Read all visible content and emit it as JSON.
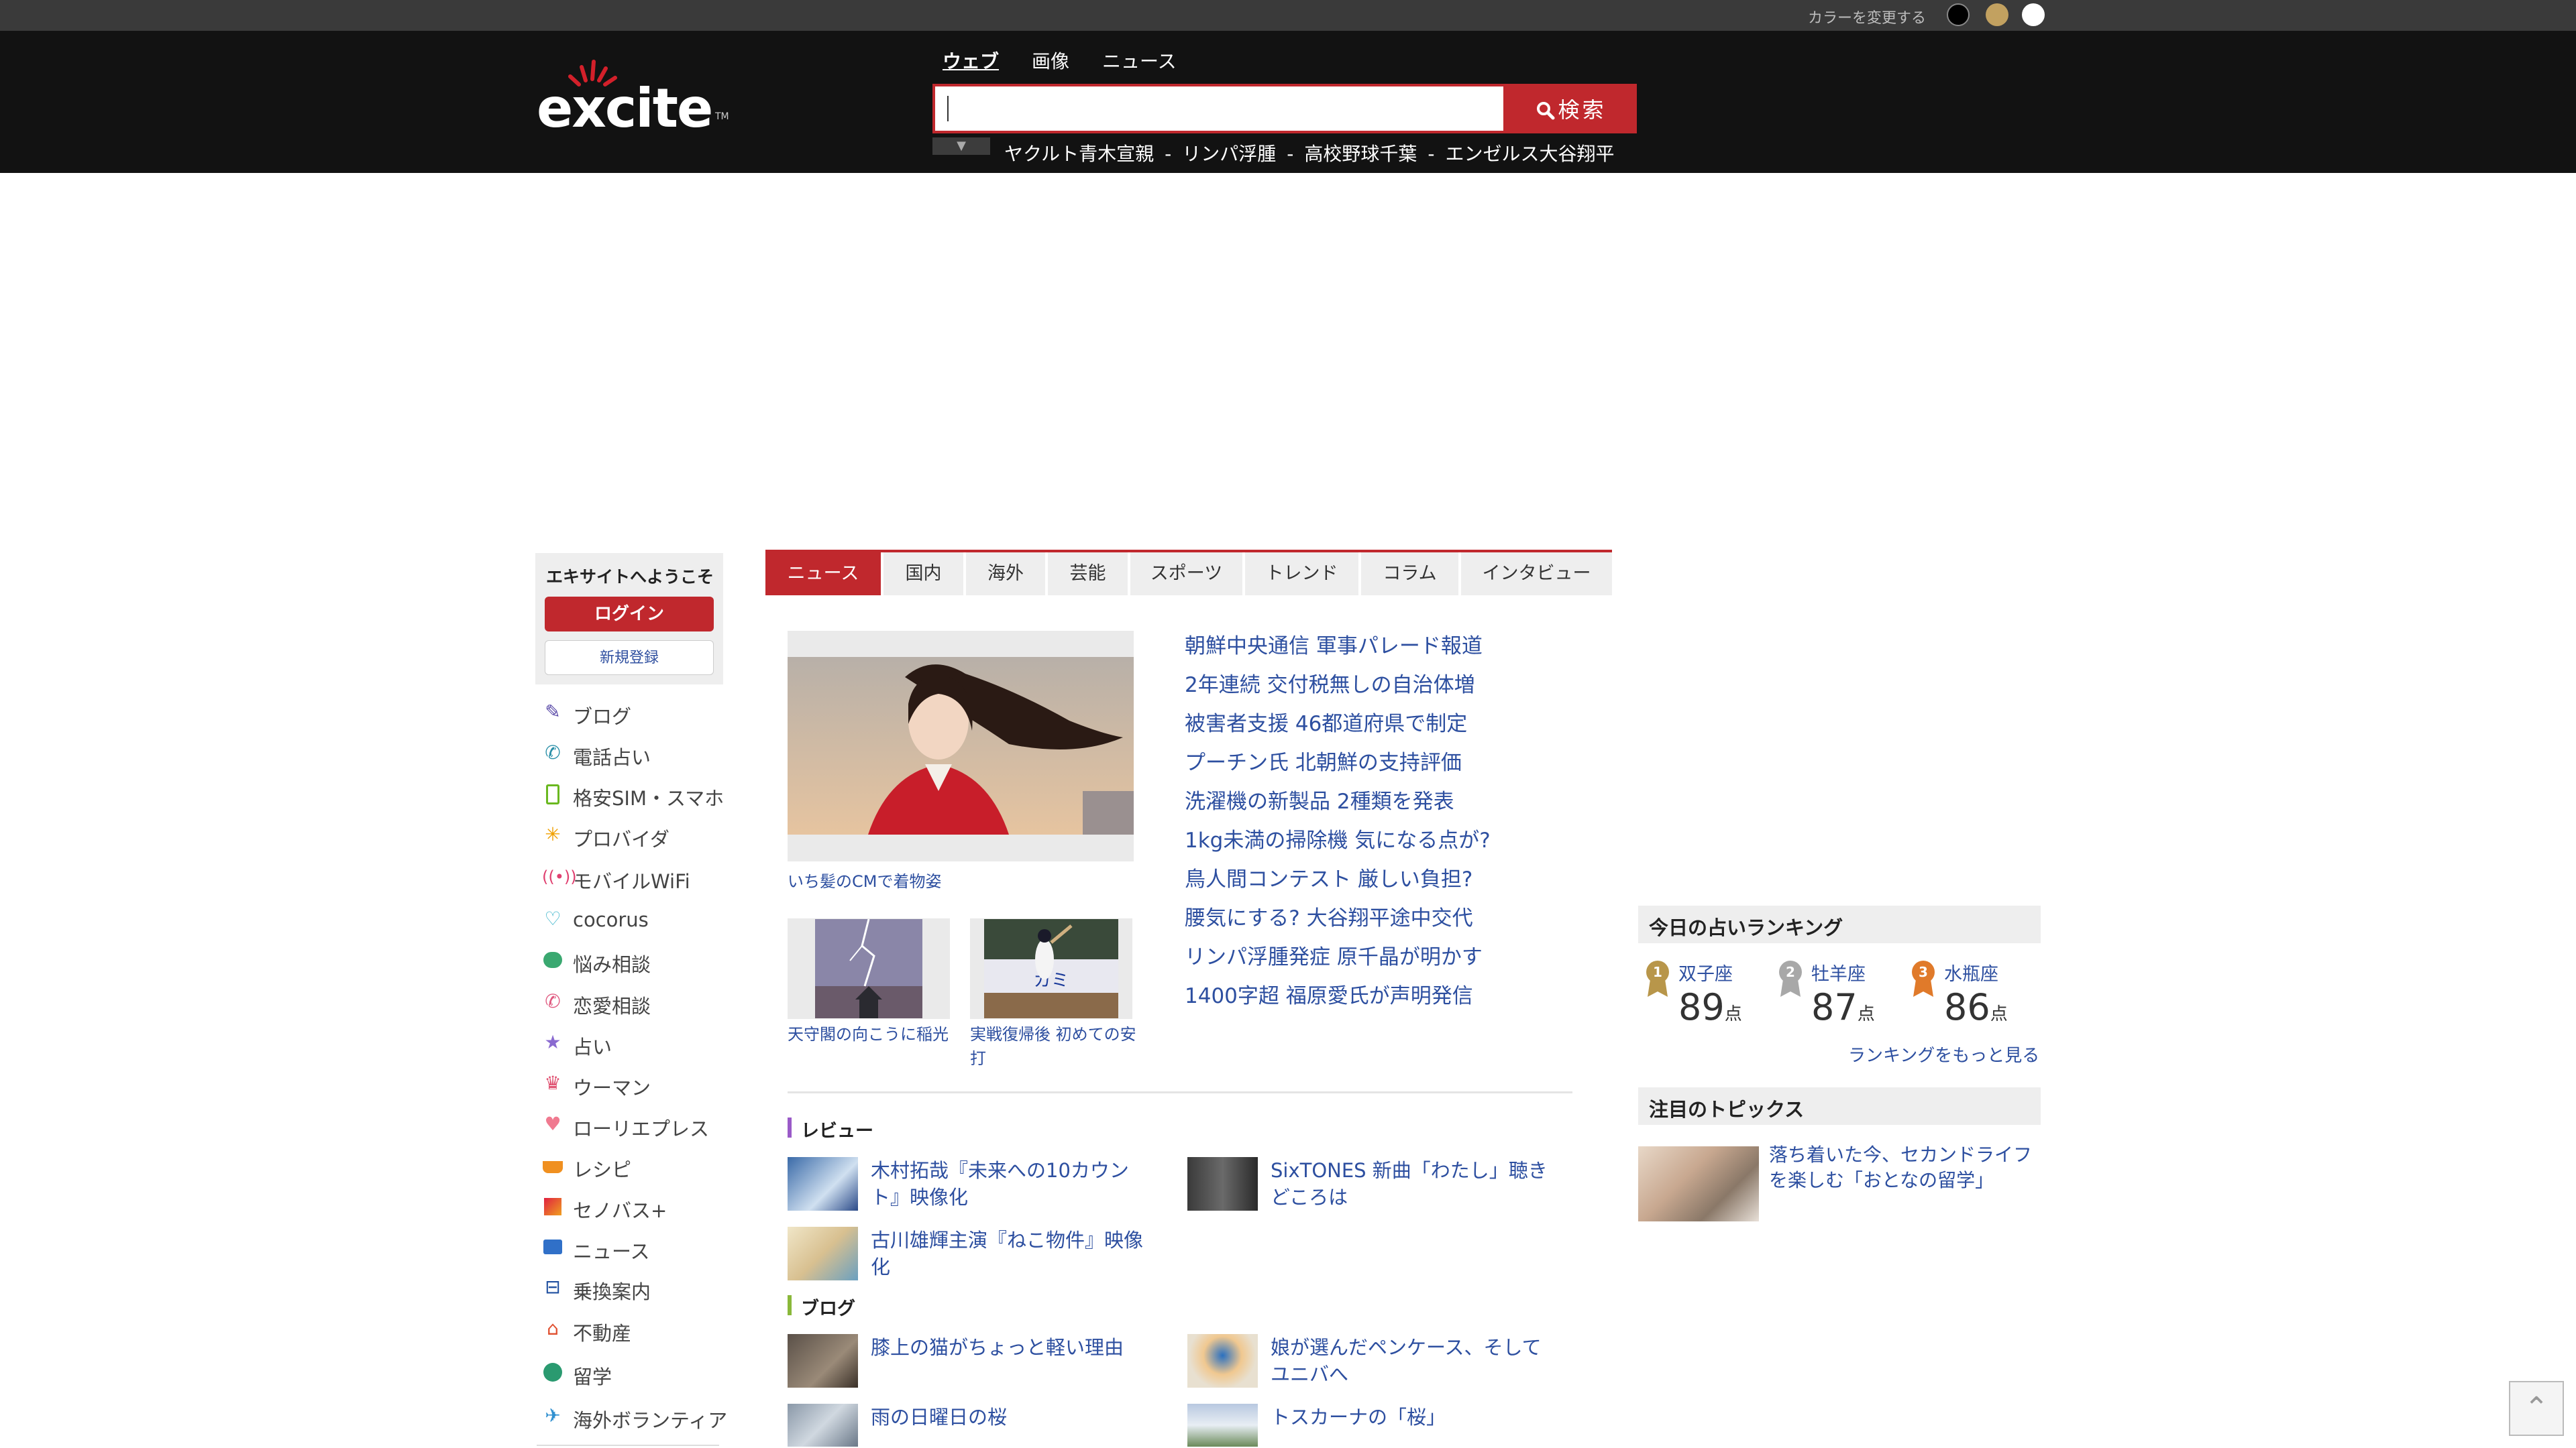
{
  "colors": {
    "brand_red": "#c0282d",
    "header_bg": "#121212",
    "link_blue": "#2d4fa0",
    "theme_options": [
      "#000000",
      "#c2a160",
      "#ffffff"
    ]
  },
  "topbar": {
    "color_change_label": "カラーを変更する"
  },
  "header": {
    "logo_text": "excite",
    "logo_tm": "TM",
    "search_tabs": [
      "ウェブ",
      "画像",
      "ニュース"
    ],
    "search_value": "",
    "search_button": "検索",
    "trending": [
      "ヤクルト青木宣親",
      "リンパ浮腫",
      "高校野球千葉",
      "エンゼルス大谷翔平"
    ],
    "separator": "-"
  },
  "sidebar": {
    "welcome": "エキサイトへようこそ",
    "login": "ログイン",
    "register": "新規登録",
    "items": [
      {
        "label": "ブログ",
        "icon": "pencil-icon"
      },
      {
        "label": "電話占い",
        "icon": "phone-icon"
      },
      {
        "label": "格安SIM・スマホ",
        "icon": "smartphone-icon"
      },
      {
        "label": "プロバイダ",
        "icon": "provider-icon"
      },
      {
        "label": "モバイルWiFi",
        "icon": "wifi-icon"
      },
      {
        "label": "cocorus",
        "icon": "heart-outline-icon"
      },
      {
        "label": "悩み相談",
        "icon": "chat-bubble-icon"
      },
      {
        "label": "恋愛相談",
        "icon": "love-phone-icon"
      },
      {
        "label": "占い",
        "icon": "star-icon"
      },
      {
        "label": "ウーマン",
        "icon": "woman-icon"
      },
      {
        "label": "ローリエプレス",
        "icon": "heart-icon"
      },
      {
        "label": "レシピ",
        "icon": "basket-icon"
      },
      {
        "label": "セノバス+",
        "icon": "palette-icon"
      },
      {
        "label": "ニュース",
        "icon": "news-icon"
      },
      {
        "label": "乗換案内",
        "icon": "train-icon"
      },
      {
        "label": "不動産",
        "icon": "house-icon"
      },
      {
        "label": "留学",
        "icon": "globe-icon"
      },
      {
        "label": "海外ボランティア",
        "icon": "plane-icon"
      }
    ]
  },
  "news_tabs": [
    "ニュース",
    "国内",
    "海外",
    "芸能",
    "スポーツ",
    "トレンド",
    "コラム",
    "インタビュー"
  ],
  "feature": {
    "caption": "いち髪のCMで着物姿",
    "thumbs": [
      {
        "caption": "天守閣の向こうに稲光"
      },
      {
        "caption": "実戦復帰後 初めての安打"
      }
    ]
  },
  "headlines": [
    "朝鮮中央通信 軍事パレード報道",
    "2年連続 交付税無しの自治体増",
    "被害者支援 46都道府県で制定",
    "プーチン氏 北朝鮮の支持評価",
    "洗濯機の新製品 2種類を発表",
    "1kg未満の掃除機 気になる点が?",
    "鳥人間コンテスト 厳しい負担?",
    "腰気にする? 大谷翔平途中交代",
    "リンパ浮腫発症 原千晶が明かす",
    "1400字超 福原愛氏が声明発信"
  ],
  "review": {
    "title": "レビュー",
    "items": [
      "木村拓哉『未来への10カウント』映像化",
      "SixTONES 新曲「わたし」聴きどころは",
      "古川雄輝主演『ねこ物件』映像化"
    ]
  },
  "blog": {
    "title": "ブログ",
    "items": [
      "膝上の猫がちょっと軽い理由",
      "娘が選んだペンケース、そしてユニバへ",
      "雨の日曜日の桜",
      "トスカーナの「桜」"
    ]
  },
  "fortune": {
    "title": "今日の占いランキング",
    "unit": "点",
    "ranks": [
      {
        "rank": "1",
        "sign": "双子座",
        "score": "89",
        "medal_color": "#b8964a"
      },
      {
        "rank": "2",
        "sign": "牡羊座",
        "score": "87",
        "medal_color": "#a8a8a8"
      },
      {
        "rank": "3",
        "sign": "水瓶座",
        "score": "86",
        "medal_color": "#e07a2a"
      }
    ],
    "more": "ランキングをもっと見る"
  },
  "topics": {
    "title": "注目のトピックス",
    "item": "落ち着いた今、セカンドライフを楽しむ「おとなの留学」"
  }
}
